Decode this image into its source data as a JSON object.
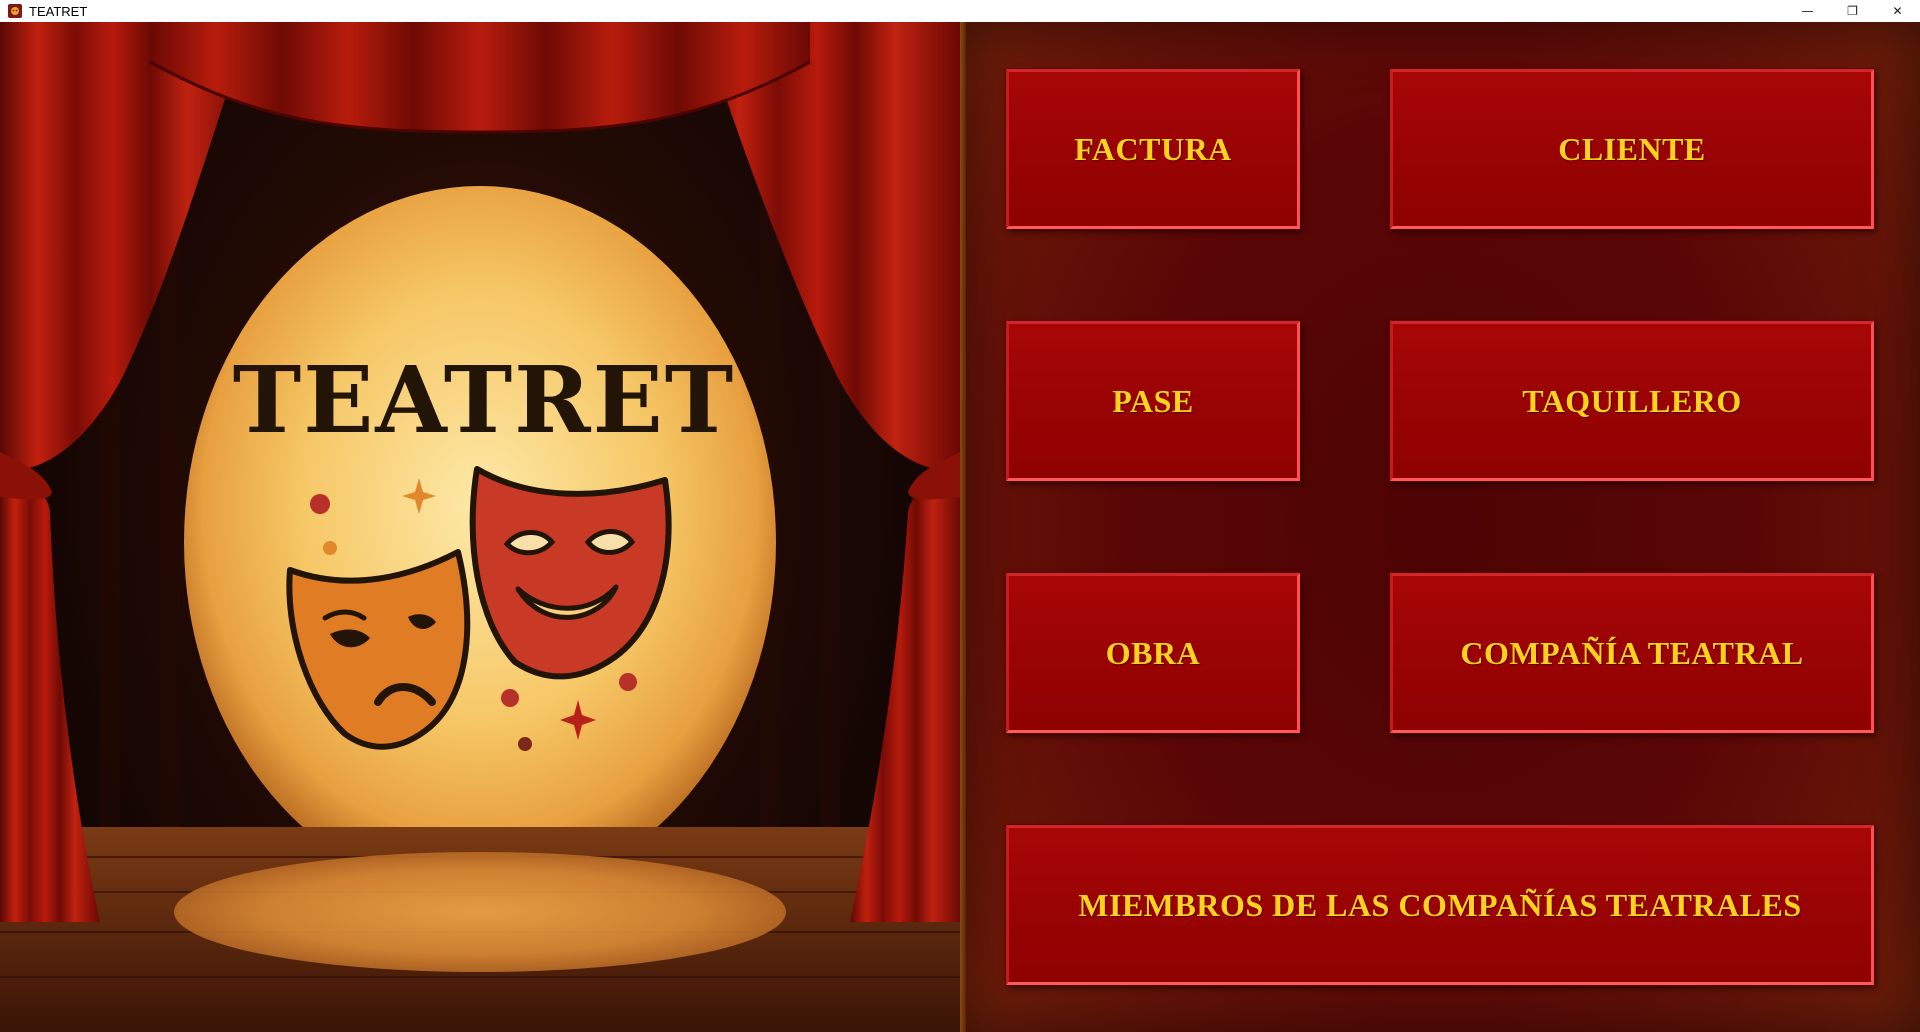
{
  "window": {
    "title": "TEATRET",
    "controls": {
      "minimize": "—",
      "restore": "❐",
      "close": "✕"
    }
  },
  "stage": {
    "logo_text": "TEATRET",
    "icons": [
      "comedy-mask-icon",
      "tragedy-mask-icon",
      "sparkle-icon"
    ]
  },
  "menu": {
    "factura": "FACTURA",
    "cliente": "CLIENTE",
    "pase": "PASE",
    "taquillero": "TAQUILLERO",
    "obra": "OBRA",
    "compania": "COMPAÑÍA TEATRAL",
    "miembros": "MIEMBROS DE LAS COMPAÑÍAS TEATRALES"
  },
  "colors": {
    "button_face": "#9a0303",
    "button_text": "#ffd21e",
    "panel_bg": "#4d0404",
    "curtain": "#b3180c",
    "spotlight": "#f7c868"
  }
}
